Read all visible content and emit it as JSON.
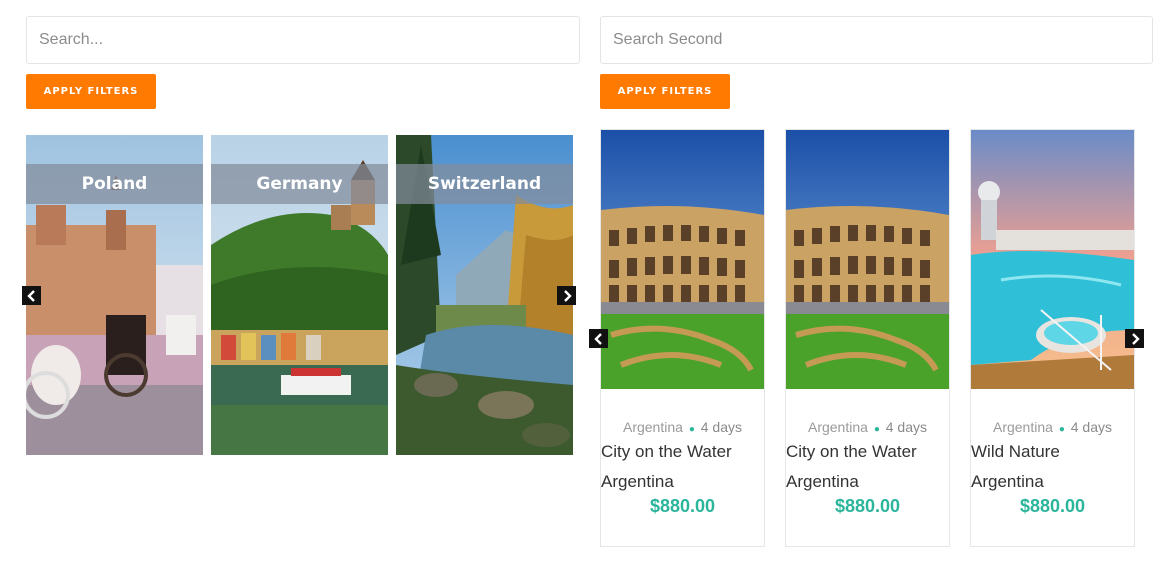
{
  "left_panel": {
    "search_placeholder": "Search...",
    "apply_label": "APPLY FILTERS",
    "destinations": [
      {
        "title": "Poland"
      },
      {
        "title": "Germany"
      },
      {
        "title": "Switzerland"
      }
    ]
  },
  "right_panel": {
    "search_placeholder": "Search Second",
    "apply_label": "APPLY FILTERS",
    "tours": [
      {
        "country": "Argentina",
        "duration": "4 days",
        "name": "City on the Water",
        "location": "Argentina",
        "price": "$880.00"
      },
      {
        "country": "Argentina",
        "duration": "4 days",
        "name": "City on the Water",
        "location": "Argentina",
        "price": "$880.00"
      },
      {
        "country": "Argentina",
        "duration": "4 days",
        "name": "Wild Nature",
        "location": "Argentina",
        "price": "$880.00"
      }
    ]
  },
  "colors": {
    "accent": "#ff7a00",
    "price": "#2bb59b",
    "overlay": "#8a93a2"
  },
  "icons": [
    "chevron-left-icon",
    "chevron-right-icon"
  ]
}
